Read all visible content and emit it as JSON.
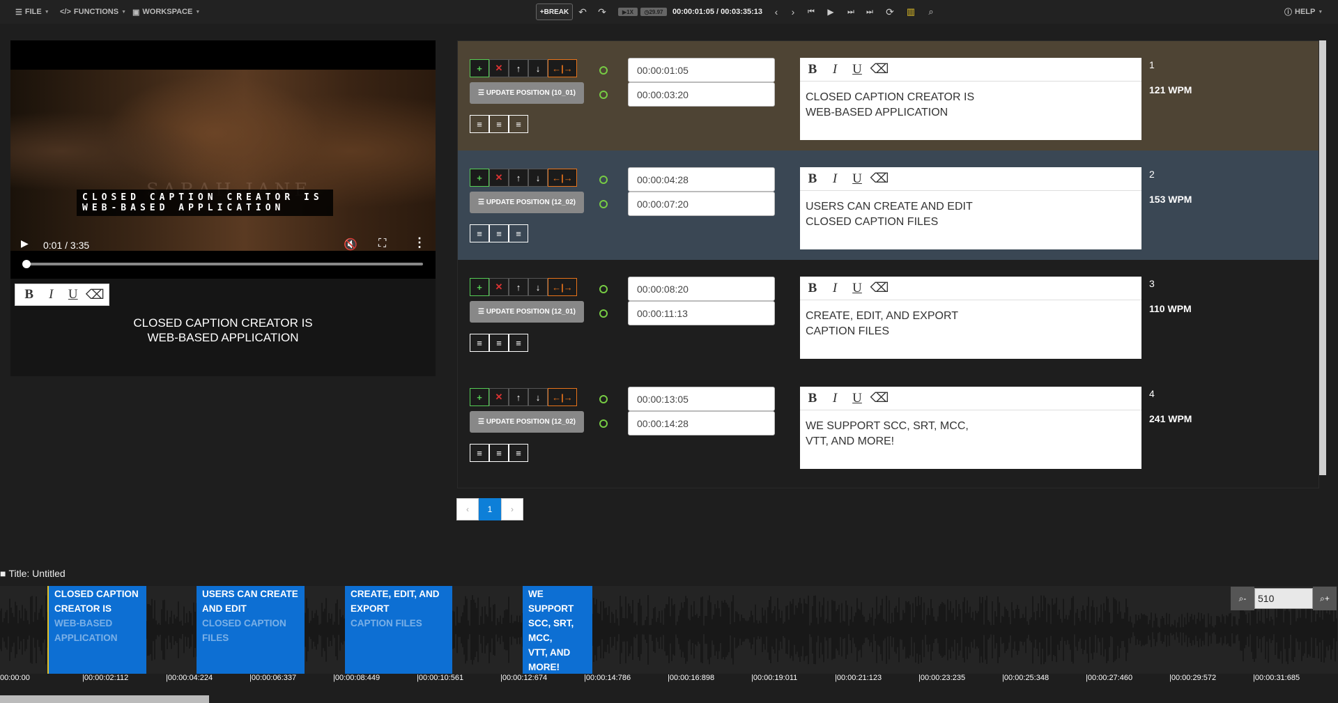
{
  "menubar": {
    "file": "FILE",
    "functions": "FUNCTIONS",
    "workspace": "WORKSPACE",
    "help": "HELP"
  },
  "toolbar": {
    "break_label": "BREAK",
    "speed": "1X",
    "fps": "29.97",
    "timecode": "00:00:01:05 / 00:03:35:13"
  },
  "player": {
    "burned_caption_line1": "CLOSED CAPTION CREATOR IS",
    "burned_caption_line2": "WEB-BASED APPLICATION",
    "watermark": "SARAH-JANE",
    "time": "0:01 / 3:35",
    "progress": 0.005
  },
  "preview": {
    "text_line1": "CLOSED CAPTION CREATOR IS",
    "text_line2": "WEB-BASED APPLICATION"
  },
  "format_labels": {
    "bold": "B",
    "italic": "I",
    "underline": "U"
  },
  "captions": [
    {
      "num": "1",
      "wpm": "121 WPM",
      "start": "00:00:01:05",
      "end": "00:00:03:20",
      "update_label": "UPDATE POSITION (10_01)",
      "text": "CLOSED CAPTION CREATOR IS\nWEB-BASED APPLICATION",
      "bg": "#4e4434"
    },
    {
      "num": "2",
      "wpm": "153 WPM",
      "start": "00:00:04:28",
      "end": "00:00:07:20",
      "update_label": "UPDATE POSITION (12_02)",
      "text": "USERS CAN CREATE AND EDIT\nCLOSED CAPTION FILES",
      "bg": "#3a4754"
    },
    {
      "num": "3",
      "wpm": "110 WPM",
      "start": "00:00:08:20",
      "end": "00:00:11:13",
      "update_label": "UPDATE POSITION (12_01)",
      "text": "CREATE, EDIT, AND EXPORT\nCAPTION FILES",
      "bg": "#1e1e1e"
    },
    {
      "num": "4",
      "wpm": "241 WPM",
      "start": "00:00:13:05",
      "end": "00:00:14:28",
      "update_label": "UPDATE POSITION (12_02)",
      "text": "WE SUPPORT SCC, SRT, MCC,\nVTT, AND MORE!",
      "bg": "#1e1e1e"
    }
  ],
  "pagination": {
    "prev": "‹",
    "current": "1",
    "next": "›"
  },
  "timeline": {
    "title": "Title: Untitled",
    "zoom_value": "510",
    "cues": [
      {
        "line1": "CLOSED CAPTION",
        "line2": "CREATOR IS",
        "line3": "WEB-BASED",
        "line4": "APPLICATION"
      },
      {
        "line1": "USERS CAN CREATE",
        "line2": "AND EDIT",
        "line3": "CLOSED CAPTION",
        "line4": "FILES"
      },
      {
        "line1": "CREATE, EDIT, AND",
        "line2": "EXPORT",
        "line3": "CAPTION FILES"
      },
      {
        "line1": "WE",
        "line2": "SUPPORT",
        "line3": "SCC, SRT,",
        "line4": "MCC,",
        "line5": "VTT, AND",
        "line6": "MORE!"
      }
    ],
    "ticks": [
      "00:00:00",
      "|00:00:02:112",
      "|00:00:04:224",
      "|00:00:06:337",
      "|00:00:08:449",
      "|00:00:10:561",
      "|00:00:12:674",
      "|00:00:14:786",
      "|00:00:16:898",
      "|00:00:19:011",
      "|00:00:21:123",
      "|00:00:23:235",
      "|00:00:25:348",
      "|00:00:27:460",
      "|00:00:29:572",
      "|00:00:31:685"
    ]
  },
  "colors": {
    "accent": "#0d6fd3",
    "playhead": "#e3c128",
    "add": "#55cc55",
    "delete": "#dd3333",
    "split": "#e8731a"
  }
}
